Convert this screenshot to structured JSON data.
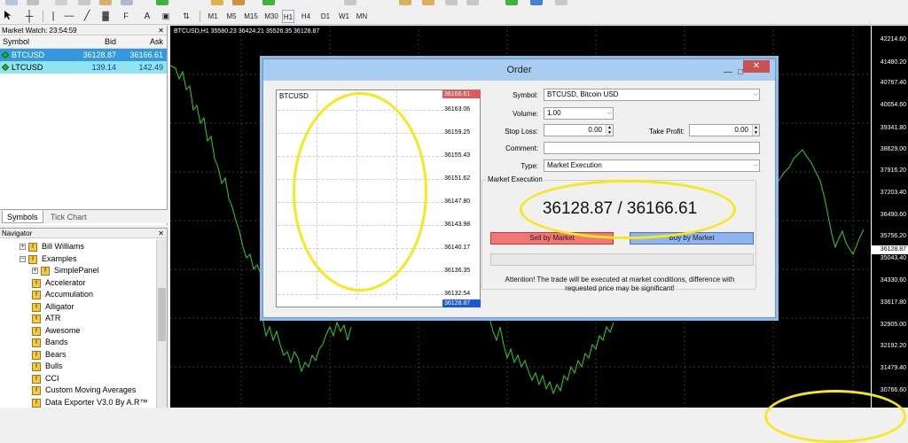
{
  "toolbar": {
    "timeframes": [
      "M1",
      "M5",
      "M15",
      "M30",
      "H1",
      "H4",
      "D1",
      "W1",
      "MN"
    ],
    "new_order_label": "New Order",
    "autotrading_label": "AutoTrading"
  },
  "market_watch": {
    "title": "Market Watch: 23:54:59",
    "columns": {
      "symbol": "Symbol",
      "bid": "Bid",
      "ask": "Ask"
    },
    "rows": [
      {
        "symbol": "BTCUSD",
        "bid": "36128.87",
        "ask": "36166.61"
      },
      {
        "symbol": "LTCUSD",
        "bid": "139.14",
        "ask": "142.49"
      }
    ],
    "tabs": [
      "Symbols",
      "Tick Chart"
    ]
  },
  "navigator": {
    "title": "Navigator",
    "items": [
      "Bill Williams",
      "Examples",
      "SimplePanel",
      "Accelerator",
      "Accumulation",
      "Alligator",
      "ATR",
      "Awesome",
      "Bands",
      "Bears",
      "Bulls",
      "CCI",
      "Custom Moving Averages",
      "Data Exporter V3.0 By A.R™"
    ]
  },
  "chart": {
    "label": "BTCUSD,H1  35580.23 36424.21 35526.35 36128.87",
    "prices": [
      "42214.60",
      "41480.20",
      "40767.40",
      "40054.60",
      "39341.80",
      "38629.00",
      "37916.20",
      "37203.40",
      "36490.60",
      "35756.20",
      "35043.40",
      "34330.60",
      "33617.80",
      "32905.00",
      "32192.20",
      "31479.40",
      "30766.60"
    ],
    "current_price": "36128.87",
    "line_color": "#2ed02e"
  },
  "order": {
    "title": "Order",
    "mini_chart": {
      "symbol": "BTCUSD",
      "ask": "36166.61",
      "bid": "36128.87",
      "prices": [
        "36163.06",
        "36159.25",
        "36155.43",
        "36151.62",
        "36147.80",
        "36143.98",
        "36140.17",
        "36136.35",
        "36132.54"
      ]
    },
    "labels": {
      "symbol": "Symbol:",
      "volume": "Volume:",
      "stop_loss": "Stop Loss:",
      "take_profit": "Take Profit:",
      "comment": "Comment:",
      "type": "Type:"
    },
    "values": {
      "symbol": "BTCUSD, Bitcoin USD",
      "volume": "1.00",
      "stop_loss": "0.00",
      "take_profit": "0.00",
      "comment": "",
      "type": "Market Execution"
    },
    "market_execution": {
      "title": "Market Execution",
      "quote": "36128.87 / 36166.61",
      "sell_label": "Sell by Market",
      "buy_label": "Buy by Market",
      "attention": "Attention! The trade will be executed at market conditions, difference with requested price may be significant!"
    }
  },
  "colors": {
    "sell": "#f27676",
    "buy": "#8fb3f0",
    "highlight": "#f6e81c",
    "selected_row": "#3398dd"
  }
}
